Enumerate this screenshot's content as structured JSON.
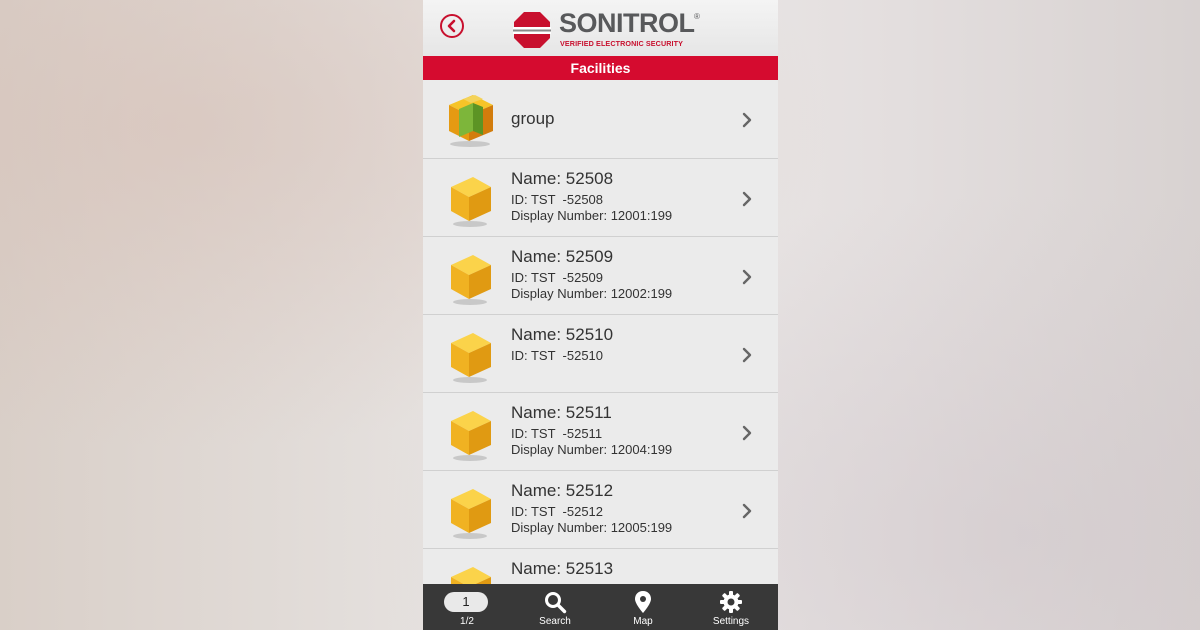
{
  "header": {
    "back_icon": "back-arrow-icon",
    "logo_text": "SONITROL",
    "logo_reg": "®",
    "logo_tagline": "VERIFIED ELECTRONIC SECURITY"
  },
  "title": "Facilities",
  "colors": {
    "accent": "#d50b2f",
    "tabbar": "#383838",
    "list_bg": "#ebebeb"
  },
  "list": [
    {
      "type": "group",
      "name": "group",
      "icon": "group-cube-icon"
    },
    {
      "type": "facility",
      "name": "Name: 52508",
      "id": "ID: TST  -52508",
      "display": "Display Number: 12001:199",
      "icon": "cube-icon"
    },
    {
      "type": "facility",
      "name": "Name: 52509",
      "id": "ID: TST  -52509",
      "display": "Display Number: 12002:199",
      "icon": "cube-icon"
    },
    {
      "type": "facility",
      "name": "Name: 52510",
      "id": "ID: TST  -52510",
      "display": "",
      "icon": "cube-icon"
    },
    {
      "type": "facility",
      "name": "Name: 52511",
      "id": "ID: TST  -52511",
      "display": "Display Number: 12004:199",
      "icon": "cube-icon"
    },
    {
      "type": "facility",
      "name": "Name: 52512",
      "id": "ID: TST  -52512",
      "display": "Display Number: 12005:199",
      "icon": "cube-icon"
    },
    {
      "type": "facility",
      "name": "Name: 52513",
      "id": "",
      "display": "",
      "icon": "cube-icon"
    }
  ],
  "tabbar": {
    "page_number": "1",
    "page_label": "1/2",
    "search_label": "Search",
    "map_label": "Map",
    "settings_label": "Settings"
  }
}
